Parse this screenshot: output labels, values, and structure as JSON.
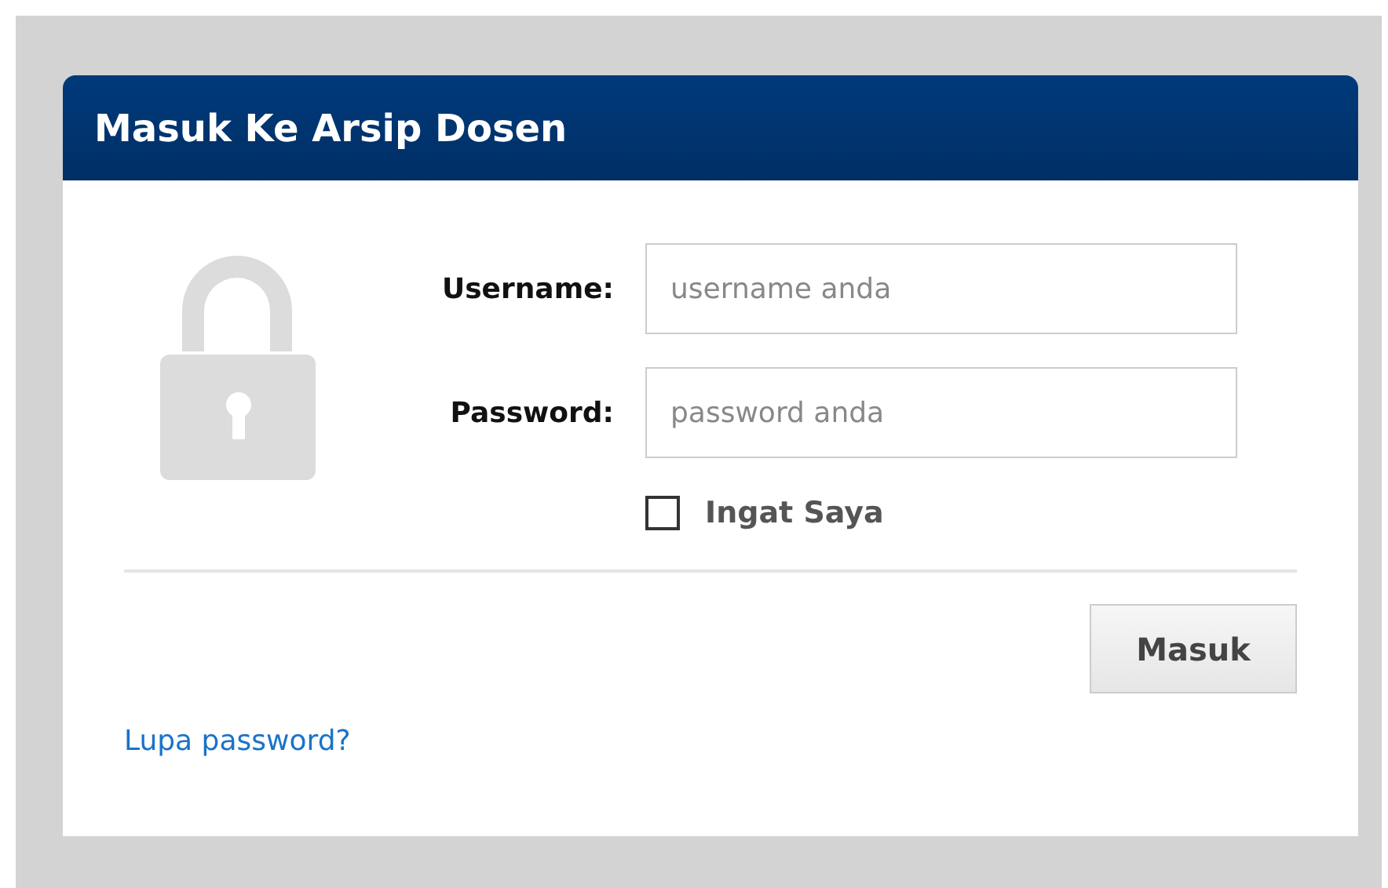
{
  "panel": {
    "title": "Masuk Ke Arsip Dosen"
  },
  "fields": [
    {
      "label": "Username:",
      "placeholder": "username anda"
    },
    {
      "label": "Password:",
      "placeholder": "password anda"
    }
  ],
  "remember": {
    "label": "Ingat Saya",
    "checked": false
  },
  "submit": "Masuk",
  "forgot_link": "Lupa password?"
}
